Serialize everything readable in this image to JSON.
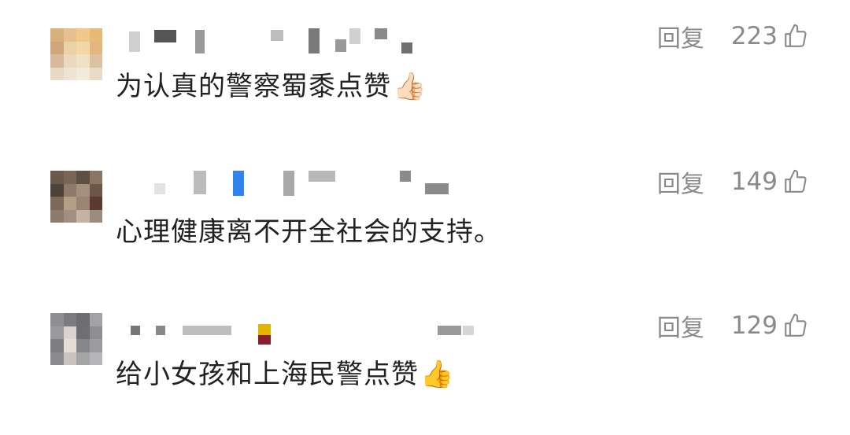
{
  "comments": [
    {
      "text": "为认真的警察蜀黍点赞",
      "emoji": "👍🏻",
      "reply_label": "回复",
      "likes": "223",
      "avatar_colors": [
        "#d8b07a",
        "#e6c18f",
        "#f0c98a",
        "#e8bb74",
        "#cfa57a",
        "#ead2a8",
        "#f3d7a5",
        "#e4b57c",
        "#d7b99b",
        "#ecd8c0",
        "#f0e0c5",
        "#dcc2a2",
        "#e8d9c5",
        "#efe3d2",
        "#f3eadc",
        "#eadbc6"
      ]
    },
    {
      "text": "心理健康离不开全社会的支持。",
      "emoji": "",
      "reply_label": "回复",
      "likes": "149",
      "avatar_colors": [
        "#6b5a4c",
        "#7a6655",
        "#5e4f44",
        "#8a7563",
        "#4e4238",
        "#8d7a6a",
        "#a48f7c",
        "#6a574a",
        "#7b6a5c",
        "#b59e88",
        "#9a8573",
        "#5d3a2f",
        "#8c7c70",
        "#a38f80",
        "#c4b3a4",
        "#9c8b7f"
      ]
    },
    {
      "text": "给小女孩和上海民警点赞",
      "emoji": "👍",
      "reply_label": "回复",
      "likes": "129",
      "avatar_colors": [
        "#8f8f92",
        "#7b7b80",
        "#6d6d72",
        "#a3a3a6",
        "#9a9a9d",
        "#d8d3d0",
        "#6e6e73",
        "#8e8e92",
        "#7d7d82",
        "#e6ddd6",
        "#85858a",
        "#9b9ba0",
        "#8c8c90",
        "#c9c2bd",
        "#a5a5a8",
        "#b6b6b9"
      ]
    }
  ]
}
